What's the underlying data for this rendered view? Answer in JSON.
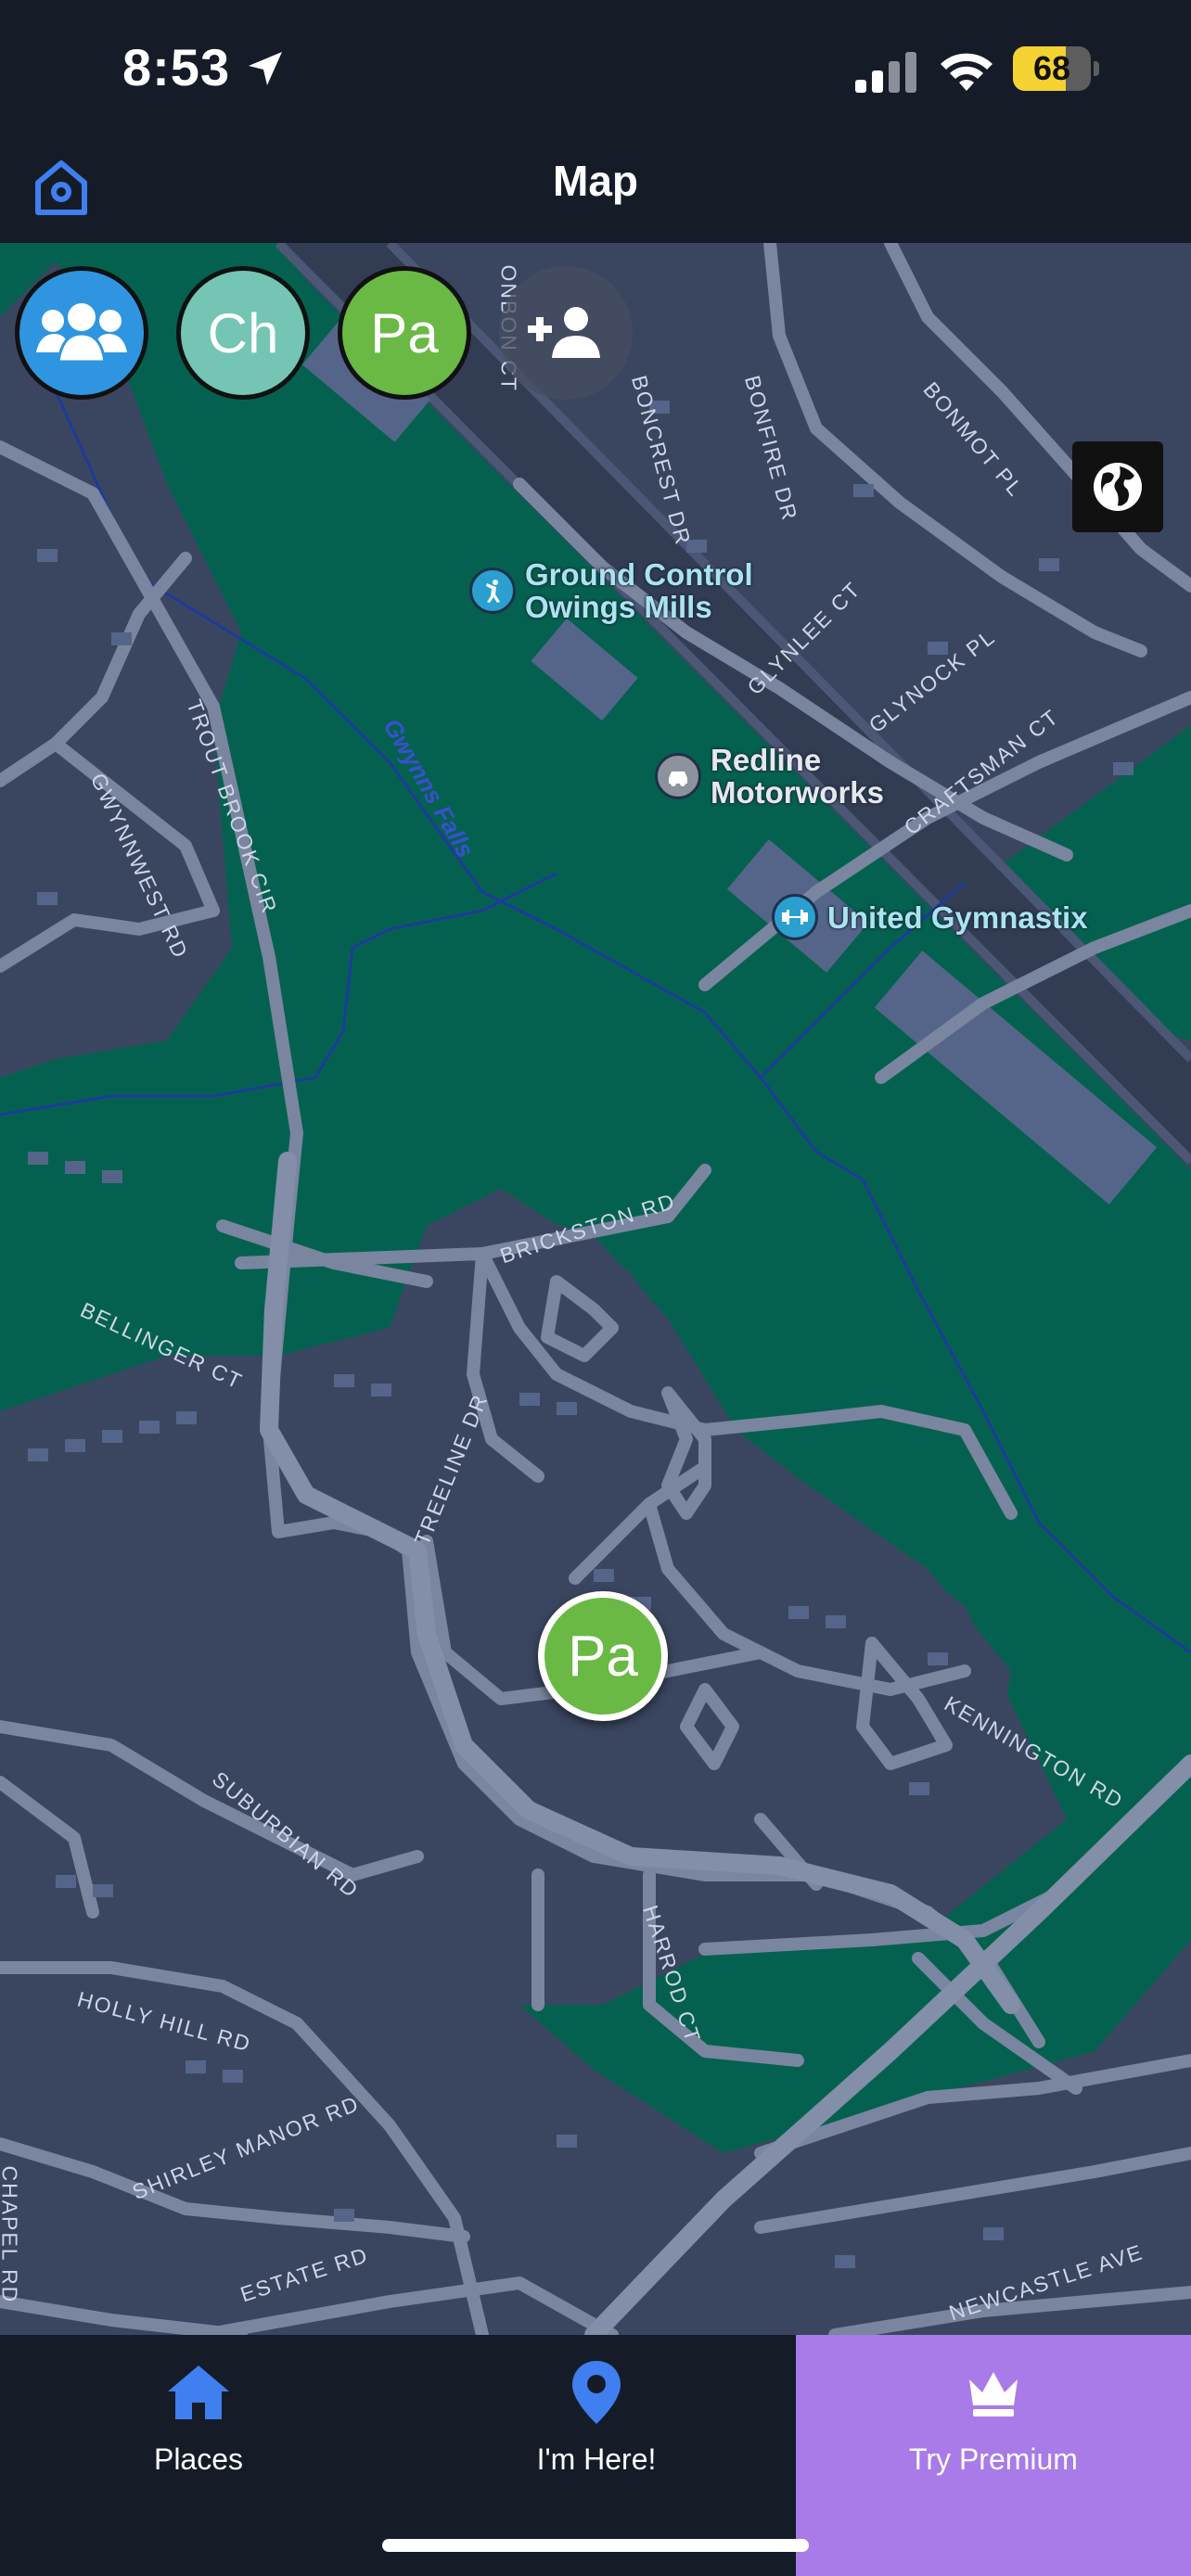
{
  "status_bar": {
    "time": "8:53",
    "battery": "68",
    "battery_level": 0.68
  },
  "nav": {
    "title": "Map"
  },
  "avatars": [
    {
      "type": "group",
      "color": "#2f95e0"
    },
    {
      "initials": "Ch",
      "color": "#74c5b3"
    },
    {
      "initials": "Pa",
      "color": "#6ab945"
    }
  ],
  "map": {
    "water_label": "Gwynns Falls",
    "pois": [
      {
        "name_line1": "Ground Control",
        "name_line2": "Owings Mills",
        "icon": "martial-arts-icon"
      },
      {
        "name_line1": "Redline",
        "name_line2": "Motorworks",
        "icon": "car-icon"
      },
      {
        "name_line1": "United Gymnastix",
        "name_line2": "",
        "icon": "dumbbell-icon"
      }
    ],
    "streets": {
      "onbon": "ONBON CT",
      "boncrest": "BONCREST DR",
      "bonfire": "BONFIRE DR",
      "bonmot": "BONMOT PL",
      "glynlee": "GLYNLEE CT",
      "glynock": "GLYNOCK PL",
      "craftsman": "CRAFTSMAN CT",
      "trout": "TROUT BROOK CIR",
      "gwynnwest": "GWYNNWEST RD",
      "brickston": "BRICKSTON RD",
      "bellinger": "BELLINGER CT",
      "treeline": "TREELINE DR",
      "kennington": "KENNINGTON RD",
      "suburbian": "SUBURBIAN RD",
      "harrod": "HARROD CT",
      "holly": "HOLLY HILL RD",
      "shirley": "SHIRLEY MANOR RD",
      "estate": "ESTATE RD",
      "newcastle": "NEWCASTLE AVE",
      "chapel": "CHAPEL RD"
    },
    "marker": {
      "initials": "Pa",
      "color": "#6ab945"
    }
  },
  "tabs": [
    {
      "label": "Places",
      "icon": "house-icon"
    },
    {
      "label": "I'm Here!",
      "icon": "location-pin-icon"
    },
    {
      "label": "Try Premium",
      "icon": "crown-icon"
    }
  ],
  "colors": {
    "accent": "#3f7ff0",
    "premium": "#a87be8",
    "park": "#05614f",
    "land": "#3a4660"
  }
}
